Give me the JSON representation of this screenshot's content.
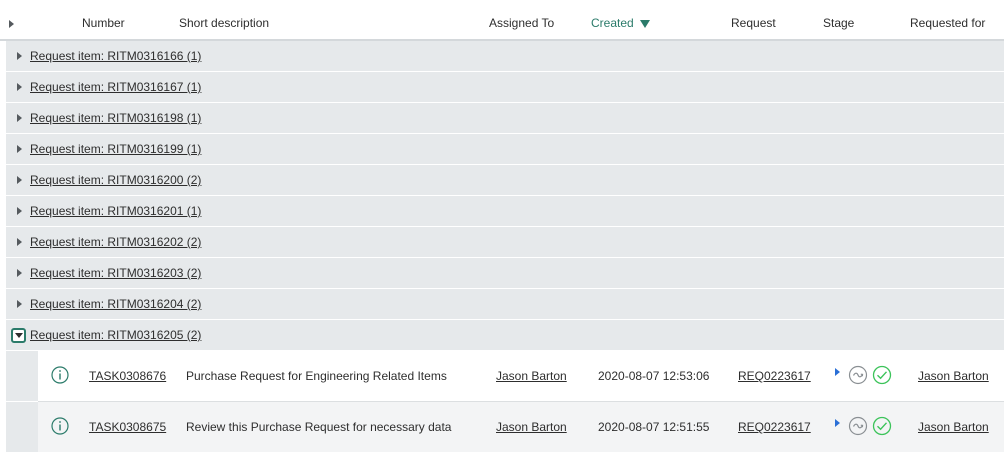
{
  "columns": {
    "number": "Number",
    "short_description": "Short description",
    "assigned_to": "Assigned To",
    "created": "Created",
    "request": "Request",
    "stage": "Stage",
    "requested_for": "Requested for"
  },
  "sort": {
    "column": "created",
    "direction": "descending"
  },
  "groups": [
    {
      "label": "Request item: RITM0316166 (1)",
      "expanded": false
    },
    {
      "label": "Request item: RITM0316167 (1)",
      "expanded": false
    },
    {
      "label": "Request item: RITM0316198 (1)",
      "expanded": false
    },
    {
      "label": "Request item: RITM0316199 (1)",
      "expanded": false
    },
    {
      "label": "Request item: RITM0316200 (2)",
      "expanded": false
    },
    {
      "label": "Request item: RITM0316201 (1)",
      "expanded": false
    },
    {
      "label": "Request item: RITM0316202 (2)",
      "expanded": false
    },
    {
      "label": "Request item: RITM0316203 (2)",
      "expanded": false
    },
    {
      "label": "Request item: RITM0316204 (2)",
      "expanded": false
    },
    {
      "label": "Request item: RITM0316205 (2)",
      "expanded": true
    }
  ],
  "tasks": [
    {
      "number": "TASK0308676",
      "short_description": "Purchase Request for Engineering Related Items",
      "assigned_to": "Jason Barton",
      "created": "2020-08-07 12:53:06",
      "request": "REQ0223617",
      "requested_for": "Jason Barton",
      "stage_icons": [
        "play-icon",
        "in-progress-icon",
        "complete-check-icon"
      ]
    },
    {
      "number": "TASK0308675",
      "short_description": "Review this Purchase Request for necessary data",
      "assigned_to": "Jason Barton",
      "created": "2020-08-07 12:51:55",
      "request": "REQ0223617",
      "requested_for": "Jason Barton",
      "stage_icons": [
        "play-icon",
        "in-progress-icon",
        "complete-check-icon"
      ]
    }
  ],
  "colors": {
    "accent": "#2b7b6a",
    "group_bg": "#e6e9eb",
    "stage_play": "#2a6fd6",
    "stage_done": "#3cc35a"
  }
}
